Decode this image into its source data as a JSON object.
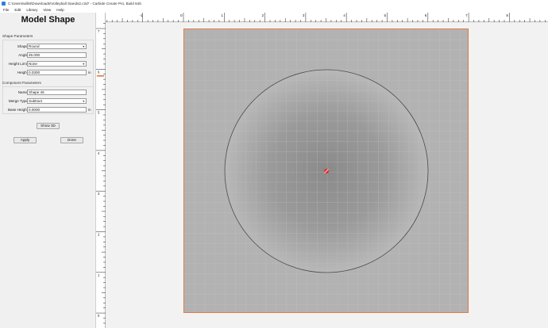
{
  "window": {
    "title": "C:\\Users\\willst\\Downloads\\Volleyball Stands2.c2d* - Carbide Create Pro, Build 645"
  },
  "menu": [
    "File",
    "Edit",
    "Library",
    "View",
    "Help"
  ],
  "panel": {
    "title": "Model Shape",
    "shape_params_label": "Shape Parameters",
    "component_params_label": "Component Parameters",
    "shape": {
      "label": "Shape",
      "value": "Round"
    },
    "angle": {
      "label": "Angle",
      "value": "45.000"
    },
    "height_limit": {
      "label": "Height Limit",
      "value": "None"
    },
    "height": {
      "label": "Height",
      "value": "0.0300",
      "unit": "in"
    },
    "name": {
      "label": "Name",
      "value": "Shape 46"
    },
    "merge_type": {
      "label": "Merge Type",
      "value": "Subtract"
    },
    "base_height": {
      "label": "Base Height",
      "value": "0.0000",
      "unit": "in"
    },
    "show3d_label": "Show 3D",
    "apply_label": "Apply",
    "done_label": "Done"
  },
  "ruler": {
    "top_labels": [
      "-1",
      "0",
      "1",
      "2",
      "3",
      "4",
      "5",
      "6",
      "7",
      "8"
    ],
    "left_labels": [
      "7",
      "6",
      "5",
      "4",
      "3",
      "2",
      "1",
      "0"
    ]
  },
  "colors": {
    "work_area": "#b2b2b2",
    "work_border": "#e07840",
    "marker": "#e03030"
  }
}
